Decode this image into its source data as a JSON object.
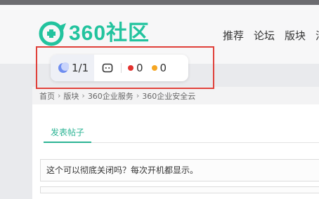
{
  "header": {
    "logo_text": "360社区",
    "nav": [
      {
        "label": "推荐"
      },
      {
        "label": "论坛"
      },
      {
        "label": "版块"
      },
      {
        "label": "活"
      }
    ]
  },
  "toolbar": {
    "progress_label": "1/1",
    "red_count": "0",
    "orange_count": "0",
    "colors": {
      "red": "#e3312e",
      "orange": "#f5a623",
      "accent": "#2cb494"
    }
  },
  "breadcrumb": {
    "items": [
      "首页",
      "版块",
      "360企业服务",
      "360企业安全云"
    ],
    "separator": "›"
  },
  "tabs": {
    "post_label": "发表帖子"
  },
  "thread": {
    "title": "这个可以彻底关闭吗？每次开机都显示。"
  }
}
